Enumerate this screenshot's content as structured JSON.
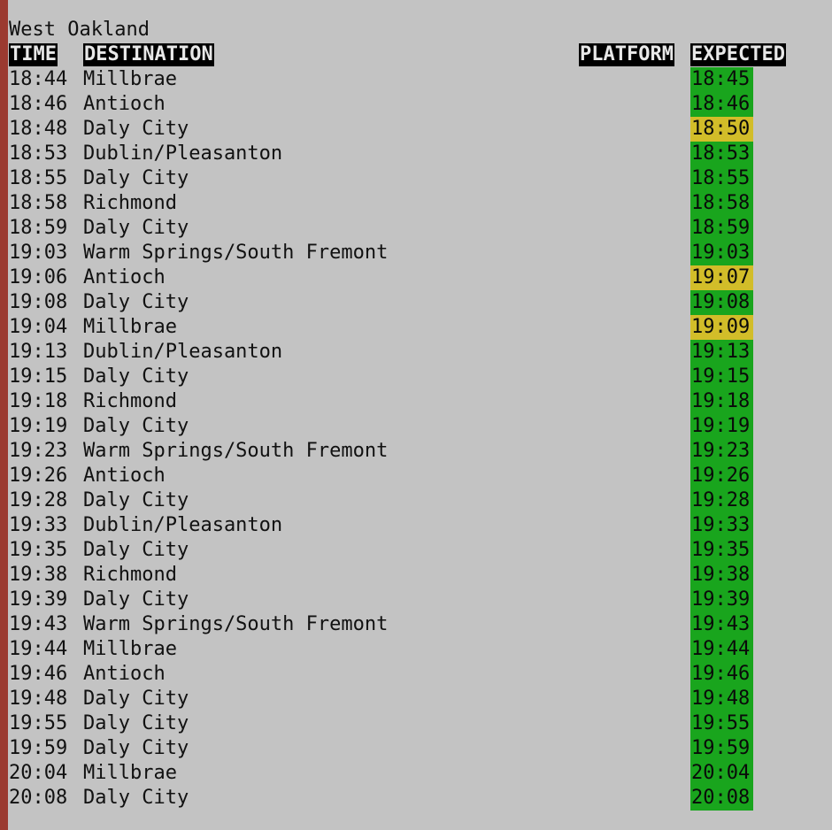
{
  "station": "West Oakland",
  "headers": {
    "time": "TIME",
    "destination": "DESTINATION",
    "platform": "PLATFORM",
    "expected": "EXPECTED"
  },
  "status_colors": {
    "on_time": "#19a51d",
    "late": "#d2bd29"
  },
  "departures": [
    {
      "time": "18:44",
      "destination": "Millbrae",
      "platform": "",
      "expected": "18:45",
      "status": "on_time"
    },
    {
      "time": "18:46",
      "destination": "Antioch",
      "platform": "",
      "expected": "18:46",
      "status": "on_time"
    },
    {
      "time": "18:48",
      "destination": "Daly City",
      "platform": "",
      "expected": "18:50",
      "status": "late"
    },
    {
      "time": "18:53",
      "destination": "Dublin/Pleasanton",
      "platform": "",
      "expected": "18:53",
      "status": "on_time"
    },
    {
      "time": "18:55",
      "destination": "Daly City",
      "platform": "",
      "expected": "18:55",
      "status": "on_time"
    },
    {
      "time": "18:58",
      "destination": "Richmond",
      "platform": "",
      "expected": "18:58",
      "status": "on_time"
    },
    {
      "time": "18:59",
      "destination": "Daly City",
      "platform": "",
      "expected": "18:59",
      "status": "on_time"
    },
    {
      "time": "19:03",
      "destination": "Warm Springs/South Fremont",
      "platform": "",
      "expected": "19:03",
      "status": "on_time"
    },
    {
      "time": "19:06",
      "destination": "Antioch",
      "platform": "",
      "expected": "19:07",
      "status": "late"
    },
    {
      "time": "19:08",
      "destination": "Daly City",
      "platform": "",
      "expected": "19:08",
      "status": "on_time"
    },
    {
      "time": "19:04",
      "destination": "Millbrae",
      "platform": "",
      "expected": "19:09",
      "status": "late"
    },
    {
      "time": "19:13",
      "destination": "Dublin/Pleasanton",
      "platform": "",
      "expected": "19:13",
      "status": "on_time"
    },
    {
      "time": "19:15",
      "destination": "Daly City",
      "platform": "",
      "expected": "19:15",
      "status": "on_time"
    },
    {
      "time": "19:18",
      "destination": "Richmond",
      "platform": "",
      "expected": "19:18",
      "status": "on_time"
    },
    {
      "time": "19:19",
      "destination": "Daly City",
      "platform": "",
      "expected": "19:19",
      "status": "on_time"
    },
    {
      "time": "19:23",
      "destination": "Warm Springs/South Fremont",
      "platform": "",
      "expected": "19:23",
      "status": "on_time"
    },
    {
      "time": "19:26",
      "destination": "Antioch",
      "platform": "",
      "expected": "19:26",
      "status": "on_time"
    },
    {
      "time": "19:28",
      "destination": "Daly City",
      "platform": "",
      "expected": "19:28",
      "status": "on_time"
    },
    {
      "time": "19:33",
      "destination": "Dublin/Pleasanton",
      "platform": "",
      "expected": "19:33",
      "status": "on_time"
    },
    {
      "time": "19:35",
      "destination": "Daly City",
      "platform": "",
      "expected": "19:35",
      "status": "on_time"
    },
    {
      "time": "19:38",
      "destination": "Richmond",
      "platform": "",
      "expected": "19:38",
      "status": "on_time"
    },
    {
      "time": "19:39",
      "destination": "Daly City",
      "platform": "",
      "expected": "19:39",
      "status": "on_time"
    },
    {
      "time": "19:43",
      "destination": "Warm Springs/South Fremont",
      "platform": "",
      "expected": "19:43",
      "status": "on_time"
    },
    {
      "time": "19:44",
      "destination": "Millbrae",
      "platform": "",
      "expected": "19:44",
      "status": "on_time"
    },
    {
      "time": "19:46",
      "destination": "Antioch",
      "platform": "",
      "expected": "19:46",
      "status": "on_time"
    },
    {
      "time": "19:48",
      "destination": "Daly City",
      "platform": "",
      "expected": "19:48",
      "status": "on_time"
    },
    {
      "time": "19:55",
      "destination": "Daly City",
      "platform": "",
      "expected": "19:55",
      "status": "on_time"
    },
    {
      "time": "19:59",
      "destination": "Daly City",
      "platform": "",
      "expected": "19:59",
      "status": "on_time"
    },
    {
      "time": "20:04",
      "destination": "Millbrae",
      "platform": "",
      "expected": "20:04",
      "status": "on_time"
    },
    {
      "time": "20:08",
      "destination": "Daly City",
      "platform": "",
      "expected": "20:08",
      "status": "on_time"
    }
  ]
}
